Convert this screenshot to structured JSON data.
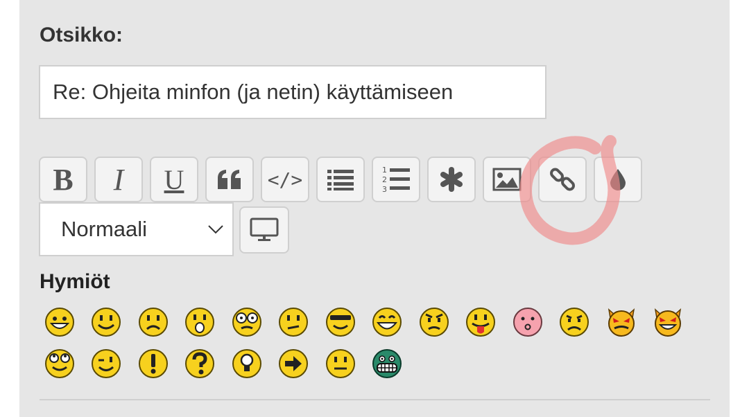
{
  "form": {
    "subject_label": "Otsikko:",
    "subject_value": "Re: Ohjeita minfon (ja netin) käyttämiseen"
  },
  "toolbar": {
    "bold_glyph": "B",
    "italic_glyph": "I",
    "underline_glyph": "U",
    "code_glyph": "</>",
    "buttons": [
      "bold",
      "italic",
      "underline",
      "quote",
      "code",
      "bulleted-list",
      "numbered-list",
      "asterisk",
      "image",
      "link",
      "color"
    ]
  },
  "font_size": {
    "selected": "Normaali"
  },
  "smileys": {
    "label": "Hymiöt",
    "row1": [
      "grin",
      "smile",
      "sad",
      "surprised",
      "eek",
      "confused",
      "cool",
      "laugh",
      "mad",
      "razz",
      "redface",
      "cry",
      "evil",
      "twisted"
    ],
    "row2": [
      "rolleyes",
      "wink",
      "exclaim",
      "question",
      "idea",
      "arrow",
      "neutral",
      "mrgreen"
    ]
  },
  "colors": {
    "panel_bg": "#e6e6e6",
    "annotation": "#f08a8a",
    "smiley_yellow": "#f7d11e",
    "smiley_green": "#2a8a6a"
  }
}
